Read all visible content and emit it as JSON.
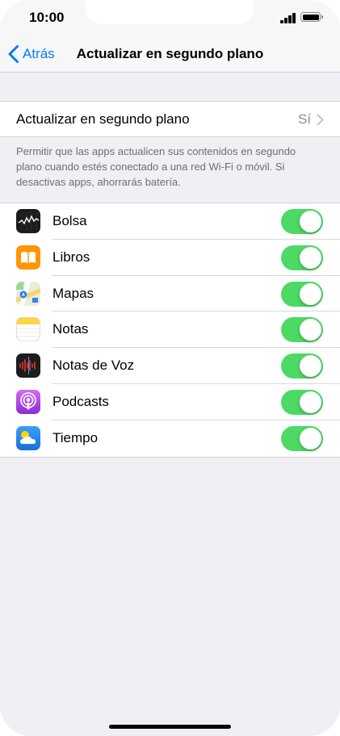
{
  "status_bar": {
    "time": "10:00"
  },
  "nav": {
    "back_label": "Atrás",
    "title": "Actualizar en segundo plano"
  },
  "main_setting": {
    "label": "Actualizar en segundo plano",
    "value": "Sí"
  },
  "footer": "Permitir que las apps actualicen sus contenidos en segundo plano cuando estés conectado a una red Wi-Fi o móvil. Si desactivas apps, ahorrarás batería.",
  "apps": [
    {
      "name": "Bolsa",
      "icon": "stocks-icon",
      "enabled": true
    },
    {
      "name": "Libros",
      "icon": "books-icon",
      "enabled": true
    },
    {
      "name": "Mapas",
      "icon": "maps-icon",
      "enabled": true
    },
    {
      "name": "Notas",
      "icon": "notes-icon",
      "enabled": true
    },
    {
      "name": "Notas de Voz",
      "icon": "voice-memos-icon",
      "enabled": true
    },
    {
      "name": "Podcasts",
      "icon": "podcasts-icon",
      "enabled": true
    },
    {
      "name": "Tiempo",
      "icon": "weather-icon",
      "enabled": true
    }
  ],
  "colors": {
    "accent": "#007aff",
    "toggle_on": "#4cd964",
    "background": "#efeff4"
  }
}
